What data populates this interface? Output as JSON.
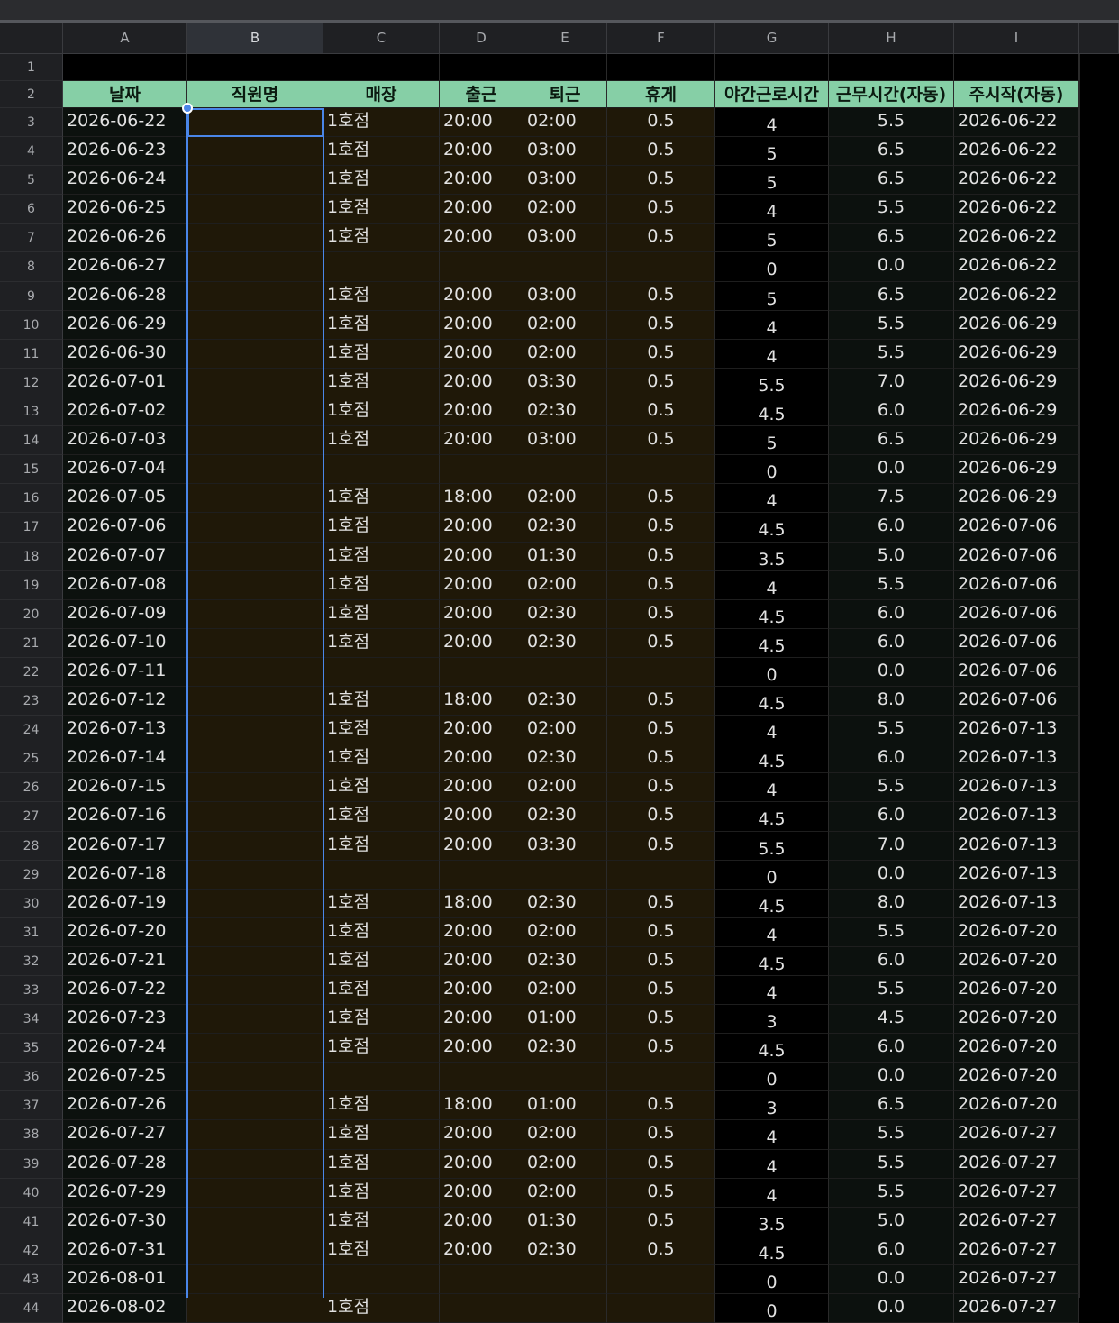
{
  "columns": [
    "A",
    "B",
    "C",
    "D",
    "E",
    "F",
    "G",
    "H",
    "I",
    ""
  ],
  "selected_column": "B",
  "header": [
    "날짜",
    "직원명",
    "매장",
    "출근",
    "퇴근",
    "휴게",
    "야간근로시간",
    "근무시간(자동)",
    "주시작(자동)"
  ],
  "rows": [
    {
      "n": "3",
      "date": "2026-06-22",
      "name": "",
      "store": "1호점",
      "in": "20:00",
      "out": "02:00",
      "brk": "0.5",
      "night": "4",
      "work": "5.5",
      "week": "2026-06-22"
    },
    {
      "n": "4",
      "date": "2026-06-23",
      "name": "",
      "store": "1호점",
      "in": "20:00",
      "out": "03:00",
      "brk": "0.5",
      "night": "5",
      "work": "6.5",
      "week": "2026-06-22"
    },
    {
      "n": "5",
      "date": "2026-06-24",
      "name": "",
      "store": "1호점",
      "in": "20:00",
      "out": "03:00",
      "brk": "0.5",
      "night": "5",
      "work": "6.5",
      "week": "2026-06-22"
    },
    {
      "n": "6",
      "date": "2026-06-25",
      "name": "",
      "store": "1호점",
      "in": "20:00",
      "out": "02:00",
      "brk": "0.5",
      "night": "4",
      "work": "5.5",
      "week": "2026-06-22"
    },
    {
      "n": "7",
      "date": "2026-06-26",
      "name": "",
      "store": "1호점",
      "in": "20:00",
      "out": "03:00",
      "brk": "0.5",
      "night": "5",
      "work": "6.5",
      "week": "2026-06-22"
    },
    {
      "n": "8",
      "date": "2026-06-27",
      "name": "",
      "store": "",
      "in": "",
      "out": "",
      "brk": "",
      "night": "0",
      "work": "0.0",
      "week": "2026-06-22"
    },
    {
      "n": "9",
      "date": "2026-06-28",
      "name": "",
      "store": "1호점",
      "in": "20:00",
      "out": "03:00",
      "brk": "0.5",
      "night": "5",
      "work": "6.5",
      "week": "2026-06-22"
    },
    {
      "n": "10",
      "date": "2026-06-29",
      "name": "",
      "store": "1호점",
      "in": "20:00",
      "out": "02:00",
      "brk": "0.5",
      "night": "4",
      "work": "5.5",
      "week": "2026-06-29"
    },
    {
      "n": "11",
      "date": "2026-06-30",
      "name": "",
      "store": "1호점",
      "in": "20:00",
      "out": "02:00",
      "brk": "0.5",
      "night": "4",
      "work": "5.5",
      "week": "2026-06-29"
    },
    {
      "n": "12",
      "date": "2026-07-01",
      "name": "",
      "store": "1호점",
      "in": "20:00",
      "out": "03:30",
      "brk": "0.5",
      "night": "5.5",
      "work": "7.0",
      "week": "2026-06-29"
    },
    {
      "n": "13",
      "date": "2026-07-02",
      "name": "",
      "store": "1호점",
      "in": "20:00",
      "out": "02:30",
      "brk": "0.5",
      "night": "4.5",
      "work": "6.0",
      "week": "2026-06-29"
    },
    {
      "n": "14",
      "date": "2026-07-03",
      "name": "",
      "store": "1호점",
      "in": "20:00",
      "out": "03:00",
      "brk": "0.5",
      "night": "5",
      "work": "6.5",
      "week": "2026-06-29"
    },
    {
      "n": "15",
      "date": "2026-07-04",
      "name": "",
      "store": "",
      "in": "",
      "out": "",
      "brk": "",
      "night": "0",
      "work": "0.0",
      "week": "2026-06-29"
    },
    {
      "n": "16",
      "date": "2026-07-05",
      "name": "",
      "store": "1호점",
      "in": "18:00",
      "out": "02:00",
      "brk": "0.5",
      "night": "4",
      "work": "7.5",
      "week": "2026-06-29"
    },
    {
      "n": "17",
      "date": "2026-07-06",
      "name": "",
      "store": "1호점",
      "in": "20:00",
      "out": "02:30",
      "brk": "0.5",
      "night": "4.5",
      "work": "6.0",
      "week": "2026-07-06"
    },
    {
      "n": "18",
      "date": "2026-07-07",
      "name": "",
      "store": "1호점",
      "in": "20:00",
      "out": "01:30",
      "brk": "0.5",
      "night": "3.5",
      "work": "5.0",
      "week": "2026-07-06"
    },
    {
      "n": "19",
      "date": "2026-07-08",
      "name": "",
      "store": "1호점",
      "in": "20:00",
      "out": "02:00",
      "brk": "0.5",
      "night": "4",
      "work": "5.5",
      "week": "2026-07-06"
    },
    {
      "n": "20",
      "date": "2026-07-09",
      "name": "",
      "store": "1호점",
      "in": "20:00",
      "out": "02:30",
      "brk": "0.5",
      "night": "4.5",
      "work": "6.0",
      "week": "2026-07-06"
    },
    {
      "n": "21",
      "date": "2026-07-10",
      "name": "",
      "store": "1호점",
      "in": "20:00",
      "out": "02:30",
      "brk": "0.5",
      "night": "4.5",
      "work": "6.0",
      "week": "2026-07-06"
    },
    {
      "n": "22",
      "date": "2026-07-11",
      "name": "",
      "store": "",
      "in": "",
      "out": "",
      "brk": "",
      "night": "0",
      "work": "0.0",
      "week": "2026-07-06"
    },
    {
      "n": "23",
      "date": "2026-07-12",
      "name": "",
      "store": "1호점",
      "in": "18:00",
      "out": "02:30",
      "brk": "0.5",
      "night": "4.5",
      "work": "8.0",
      "week": "2026-07-06"
    },
    {
      "n": "24",
      "date": "2026-07-13",
      "name": "",
      "store": "1호점",
      "in": "20:00",
      "out": "02:00",
      "brk": "0.5",
      "night": "4",
      "work": "5.5",
      "week": "2026-07-13"
    },
    {
      "n": "25",
      "date": "2026-07-14",
      "name": "",
      "store": "1호점",
      "in": "20:00",
      "out": "02:30",
      "brk": "0.5",
      "night": "4.5",
      "work": "6.0",
      "week": "2026-07-13"
    },
    {
      "n": "26",
      "date": "2026-07-15",
      "name": "",
      "store": "1호점",
      "in": "20:00",
      "out": "02:00",
      "brk": "0.5",
      "night": "4",
      "work": "5.5",
      "week": "2026-07-13"
    },
    {
      "n": "27",
      "date": "2026-07-16",
      "name": "",
      "store": "1호점",
      "in": "20:00",
      "out": "02:30",
      "brk": "0.5",
      "night": "4.5",
      "work": "6.0",
      "week": "2026-07-13"
    },
    {
      "n": "28",
      "date": "2026-07-17",
      "name": "",
      "store": "1호점",
      "in": "20:00",
      "out": "03:30",
      "brk": "0.5",
      "night": "5.5",
      "work": "7.0",
      "week": "2026-07-13"
    },
    {
      "n": "29",
      "date": "2026-07-18",
      "name": "",
      "store": "",
      "in": "",
      "out": "",
      "brk": "",
      "night": "0",
      "work": "0.0",
      "week": "2026-07-13"
    },
    {
      "n": "30",
      "date": "2026-07-19",
      "name": "",
      "store": "1호점",
      "in": "18:00",
      "out": "02:30",
      "brk": "0.5",
      "night": "4.5",
      "work": "8.0",
      "week": "2026-07-13"
    },
    {
      "n": "31",
      "date": "2026-07-20",
      "name": "",
      "store": "1호점",
      "in": "20:00",
      "out": "02:00",
      "brk": "0.5",
      "night": "4",
      "work": "5.5",
      "week": "2026-07-20"
    },
    {
      "n": "32",
      "date": "2026-07-21",
      "name": "",
      "store": "1호점",
      "in": "20:00",
      "out": "02:30",
      "brk": "0.5",
      "night": "4.5",
      "work": "6.0",
      "week": "2026-07-20"
    },
    {
      "n": "33",
      "date": "2026-07-22",
      "name": "",
      "store": "1호점",
      "in": "20:00",
      "out": "02:00",
      "brk": "0.5",
      "night": "4",
      "work": "5.5",
      "week": "2026-07-20"
    },
    {
      "n": "34",
      "date": "2026-07-23",
      "name": "",
      "store": "1호점",
      "in": "20:00",
      "out": "01:00",
      "brk": "0.5",
      "night": "3",
      "work": "4.5",
      "week": "2026-07-20"
    },
    {
      "n": "35",
      "date": "2026-07-24",
      "name": "",
      "store": "1호점",
      "in": "20:00",
      "out": "02:30",
      "brk": "0.5",
      "night": "4.5",
      "work": "6.0",
      "week": "2026-07-20"
    },
    {
      "n": "36",
      "date": "2026-07-25",
      "name": "",
      "store": "",
      "in": "",
      "out": "",
      "brk": "",
      "night": "0",
      "work": "0.0",
      "week": "2026-07-20"
    },
    {
      "n": "37",
      "date": "2026-07-26",
      "name": "",
      "store": "1호점",
      "in": "18:00",
      "out": "01:00",
      "brk": "0.5",
      "night": "3",
      "work": "6.5",
      "week": "2026-07-20"
    },
    {
      "n": "38",
      "date": "2026-07-27",
      "name": "",
      "store": "1호점",
      "in": "20:00",
      "out": "02:00",
      "brk": "0.5",
      "night": "4",
      "work": "5.5",
      "week": "2026-07-27"
    },
    {
      "n": "39",
      "date": "2026-07-28",
      "name": "",
      "store": "1호점",
      "in": "20:00",
      "out": "02:00",
      "brk": "0.5",
      "night": "4",
      "work": "5.5",
      "week": "2026-07-27"
    },
    {
      "n": "40",
      "date": "2026-07-29",
      "name": "",
      "store": "1호점",
      "in": "20:00",
      "out": "02:00",
      "brk": "0.5",
      "night": "4",
      "work": "5.5",
      "week": "2026-07-27"
    },
    {
      "n": "41",
      "date": "2026-07-30",
      "name": "",
      "store": "1호점",
      "in": "20:00",
      "out": "01:30",
      "brk": "0.5",
      "night": "3.5",
      "work": "5.0",
      "week": "2026-07-27"
    },
    {
      "n": "42",
      "date": "2026-07-31",
      "name": "",
      "store": "1호점",
      "in": "20:00",
      "out": "02:30",
      "brk": "0.5",
      "night": "4.5",
      "work": "6.0",
      "week": "2026-07-27"
    },
    {
      "n": "43",
      "date": "2026-08-01",
      "name": "",
      "store": "",
      "in": "",
      "out": "",
      "brk": "",
      "night": "0",
      "work": "0.0",
      "week": "2026-07-27"
    },
    {
      "n": "44",
      "date": "2026-08-02",
      "name": "",
      "store": "1호점",
      "in": "",
      "out": "",
      "brk": "",
      "night": "0",
      "work": "0.0",
      "week": "2026-07-27"
    }
  ],
  "row_labels": [
    "1",
    "2"
  ],
  "colors": {
    "header_bg": "#86cfa6",
    "input_bg": "#1f1808",
    "selection": "#4a86e8"
  }
}
